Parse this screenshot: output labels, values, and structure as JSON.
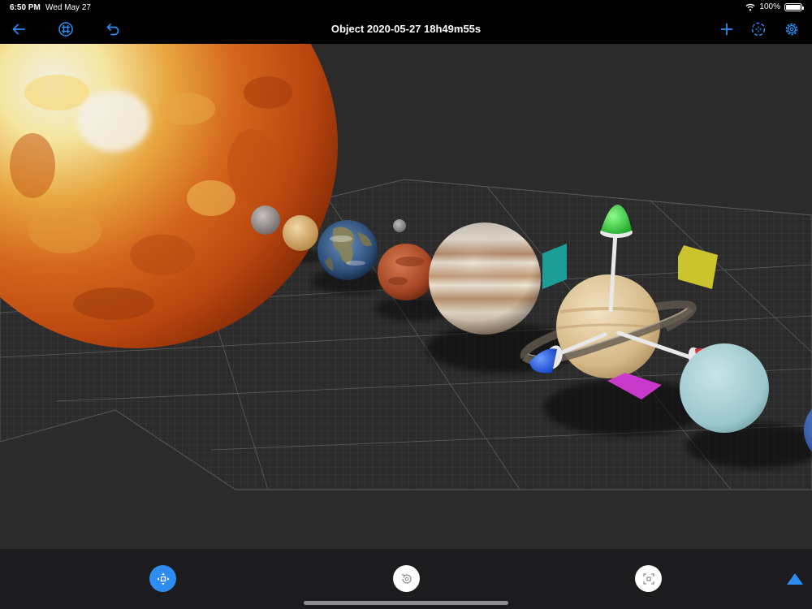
{
  "status_bar": {
    "time": "6:50 PM",
    "date": "Wed May 27",
    "battery_percent": "100%",
    "battery_level": 1.0
  },
  "nav": {
    "title": "Object 2020-05-27 18h49m55s",
    "left_icons": [
      "back-arrow-icon",
      "grid-icon",
      "undo-icon"
    ],
    "right_icons": [
      "plus-icon",
      "focus-icon",
      "gear-icon"
    ]
  },
  "scene": {
    "objects": [
      "sun",
      "mercury",
      "venus",
      "earth",
      "moon",
      "mars",
      "jupiter",
      "saturn",
      "uranus",
      "neptune"
    ],
    "gizmo_axes": {
      "y": "#2ecc40",
      "x": "#e0201f",
      "z": "#1f5be0"
    },
    "plane_handles": {
      "xy": "#d4cc2c",
      "yz": "#1aa8a0",
      "xz": "#d23ad4"
    }
  },
  "toolbar": {
    "modes": [
      {
        "name": "move-mode",
        "icon": "move-arrows-icon",
        "active": true
      },
      {
        "name": "rotate-mode",
        "icon": "rotate-icon",
        "active": false
      },
      {
        "name": "scale-mode",
        "icon": "scale-icon",
        "active": false
      }
    ],
    "expand_icon": "triangle-up-icon",
    "accent": "#2d8cf0"
  }
}
